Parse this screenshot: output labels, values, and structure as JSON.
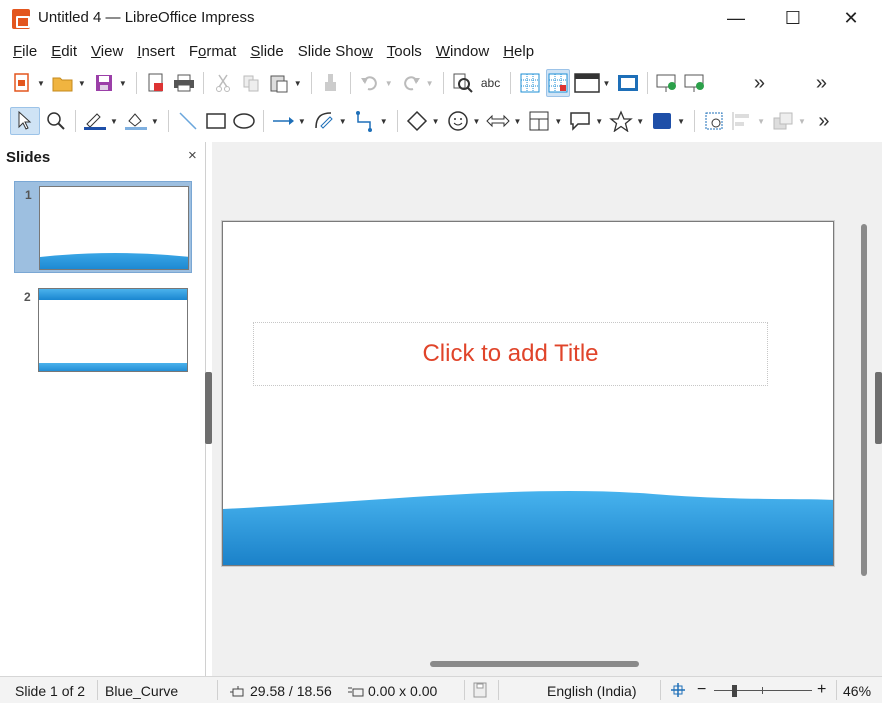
{
  "window": {
    "title": "Untitled 4 — LibreOffice Impress",
    "minimize": "—",
    "maximize": "☐",
    "close": "✕"
  },
  "menu": [
    {
      "pre": "",
      "ul": "F",
      "post": "ile"
    },
    {
      "pre": "",
      "ul": "E",
      "post": "dit"
    },
    {
      "pre": "",
      "ul": "V",
      "post": "iew"
    },
    {
      "pre": "",
      "ul": "I",
      "post": "nsert"
    },
    {
      "pre": "F",
      "ul": "o",
      "post": "rmat"
    },
    {
      "pre": "",
      "ul": "S",
      "post": "lide"
    },
    {
      "pre": "Slide Sho",
      "ul": "w",
      "post": ""
    },
    {
      "pre": "",
      "ul": "T",
      "post": "ools"
    },
    {
      "pre": "",
      "ul": "W",
      "post": "indow"
    },
    {
      "pre": "",
      "ul": "H",
      "post": "elp"
    }
  ],
  "slides_panel": {
    "title": "Slides",
    "close": "×",
    "thumbs": [
      {
        "number": "1"
      },
      {
        "number": "2"
      }
    ]
  },
  "slide": {
    "title_placeholder": "Click to add Title"
  },
  "toolbar": {
    "overflow": "»",
    "spellcheck_label": "abc"
  },
  "status": {
    "slide_info": "Slide 1 of 2",
    "master": "Blue_Curve",
    "position": "29.58 / 18.56",
    "size": "0.00 x 0.00",
    "language": "English (India)",
    "zoom_minus": "−",
    "zoom_plus": "+",
    "zoom": "46%"
  },
  "colors": {
    "accent": "#1e8fd6",
    "title_red": "#e0442a",
    "selection": "#9dbfe0"
  }
}
